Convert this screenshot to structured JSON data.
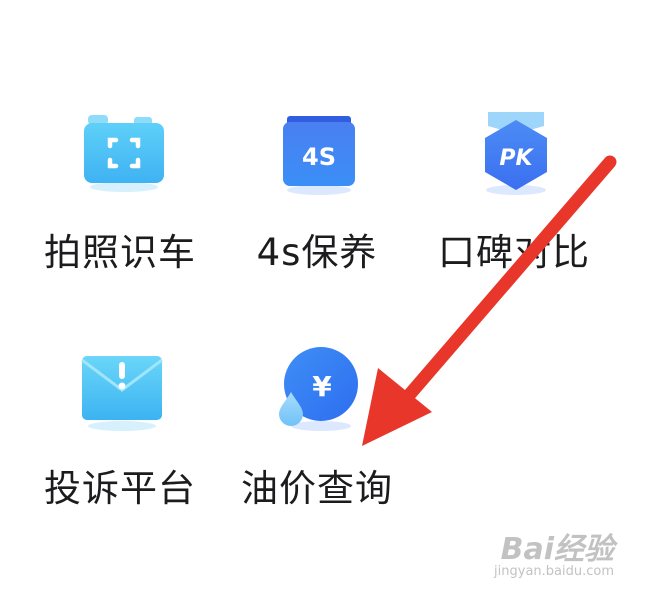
{
  "grid": {
    "items": [
      {
        "label": "拍照识车",
        "icon": "camera-scan-icon"
      },
      {
        "label": "4s保养",
        "icon": "4s-badge-icon",
        "icon_text": "4S"
      },
      {
        "label": "口碑对比",
        "icon": "pk-hexagon-icon",
        "icon_text": "PK"
      },
      {
        "label": "投诉平台",
        "icon": "envelope-alert-icon",
        "icon_text": "!"
      },
      {
        "label": "油价查询",
        "icon": "yuan-coin-drop-icon",
        "icon_text": "¥"
      }
    ]
  },
  "annotation": {
    "arrow_color": "#e8362a",
    "points_to": "油价查询"
  },
  "watermark": {
    "main": "Bai经验",
    "sub": "jingyan.baidu.com"
  },
  "colors": {
    "icon_light_blue": "#4fc0f5",
    "icon_mid_blue": "#3d8ef5",
    "icon_deep_blue": "#2f6ff0",
    "label_text": "#1c1c1e"
  }
}
